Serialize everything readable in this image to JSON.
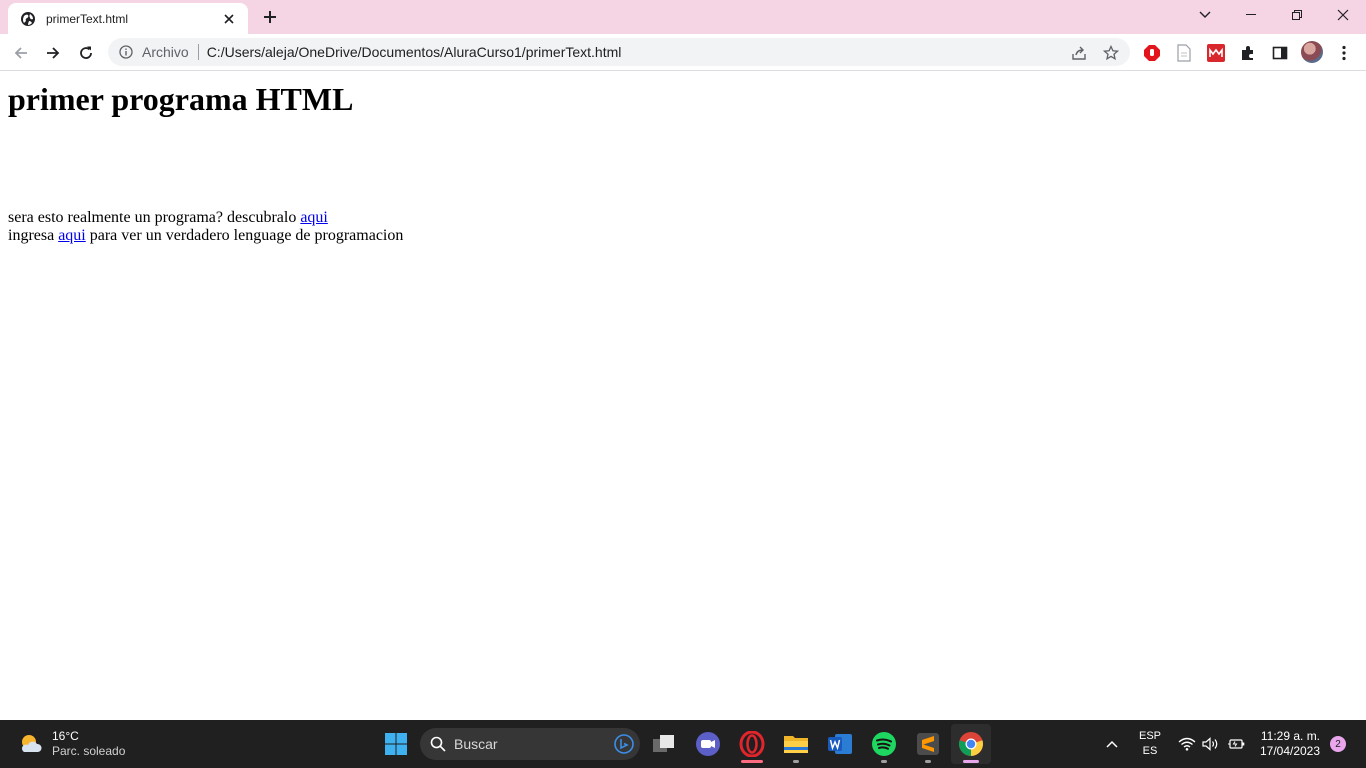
{
  "browser": {
    "tab": {
      "title": "primerText.html"
    },
    "address": {
      "scheme_label": "Archivo",
      "url": "C:/Users/aleja/OneDrive/Documentos/AluraCurso1/primerText.html"
    },
    "icons": {
      "favicon": "globe-icon",
      "close": "close-icon",
      "new_tab": "plus-icon",
      "tab_search": "chevron-down-icon",
      "minimize": "minimize-icon",
      "restore": "restore-icon",
      "window_close": "close-icon",
      "back": "arrow-left-icon",
      "forward": "arrow-right-icon",
      "reload": "reload-icon",
      "info": "info-icon",
      "share": "share-icon",
      "bookmark": "star-icon",
      "menu": "kebab-menu-icon"
    },
    "extensions": [
      "adblock-icon",
      "document-icon",
      "mega-icon",
      "puzzle-icon",
      "side-panel-icon"
    ]
  },
  "page": {
    "heading": "primer programa HTML",
    "line1": {
      "text": "sera esto realmente un programa? descubralo ",
      "link": "aqui"
    },
    "line2": {
      "before": "ingresa ",
      "link": "aqui",
      "after": " para ver un verdadero lenguage de programacion"
    }
  },
  "taskbar": {
    "weather": {
      "temp": "16°C",
      "condition": "Parc. soleado"
    },
    "search_placeholder": "Buscar",
    "language": {
      "top": "ESP",
      "bottom": "ES"
    },
    "clock": {
      "time": "11:29 a. m.",
      "date": "17/04/2023"
    },
    "notification_count": "2",
    "apps": [
      "windows-start-icon",
      "task-view-icon",
      "teams-icon",
      "opera-icon",
      "file-explorer-icon",
      "word-icon",
      "spotify-icon",
      "sublime-text-icon",
      "chrome-icon"
    ]
  },
  "colors": {
    "tabstrip": "#f5d5e4",
    "link": "#0000ee",
    "taskbar": "#202020"
  }
}
